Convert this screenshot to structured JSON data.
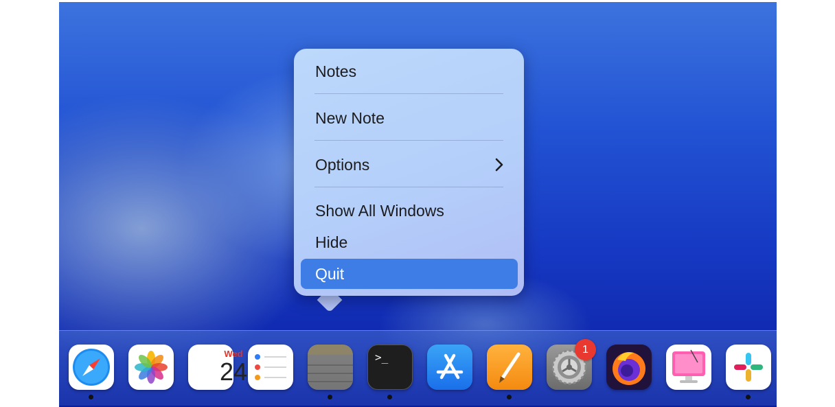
{
  "context_menu": {
    "items": [
      {
        "label": "Notes"
      },
      {
        "label": "New Note"
      },
      {
        "label": "Options"
      },
      {
        "label": "Show All Windows"
      },
      {
        "label": "Hide"
      },
      {
        "label": "Quit",
        "highlighted": true
      }
    ],
    "submenu_icon": "chevron-right-icon"
  },
  "dock": {
    "apps": [
      {
        "name": "Safari",
        "icon": "safari-compass-icon",
        "running": true
      },
      {
        "name": "Photos",
        "icon": "photos-flower-icon",
        "running": false
      },
      {
        "name": "Calendar",
        "icon": "calendar-icon",
        "running": false,
        "day": "Wed",
        "date": "24"
      },
      {
        "name": "Reminders",
        "icon": "reminders-list-icon",
        "running": false
      },
      {
        "name": "Notes",
        "icon": "notes-icon",
        "running": true
      },
      {
        "name": "Terminal",
        "icon": "terminal-icon",
        "running": true,
        "prompt": ">_"
      },
      {
        "name": "App Store",
        "icon": "app-store-icon",
        "running": false
      },
      {
        "name": "Pages",
        "icon": "pages-pen-icon",
        "running": true
      },
      {
        "name": "System Settings",
        "icon": "gear-icon",
        "running": false,
        "badge": "1"
      },
      {
        "name": "Firefox",
        "icon": "firefox-icon",
        "running": false
      },
      {
        "name": "CleanMyMac",
        "icon": "cleanmymac-icon",
        "running": false
      },
      {
        "name": "Slack",
        "icon": "slack-icon",
        "running": true
      }
    ]
  },
  "colors": {
    "menu_highlight": "#3f7de6",
    "badge": "#e8382f"
  }
}
